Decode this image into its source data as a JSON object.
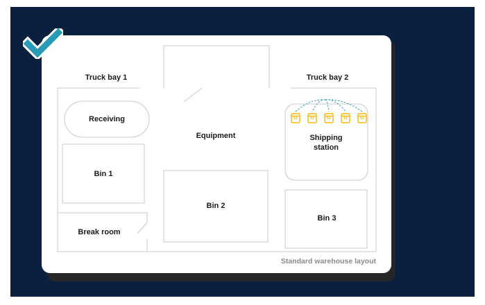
{
  "diagram": {
    "areas": {
      "truck_bay_1": "Truck bay 1",
      "truck_bay_2": "Truck bay 2",
      "receiving": "Receiving",
      "equipment": "Equipment",
      "shipping_station": "Shipping station",
      "bin_1": "Bin 1",
      "bin_2": "Bin 2",
      "bin_3": "Bin 3",
      "break_room": "Break room"
    },
    "caption": "Standard warehouse layout",
    "package_count": 5,
    "colors": {
      "background": "#0b1f3f",
      "card": "#ffffff",
      "card_shadow": "#262626",
      "outline": "#c8c8c8",
      "checkmark": "#2a9bb7",
      "package": "#f2b705",
      "route": "#2a9bb7",
      "caption": "#8a8a8a"
    },
    "icons": [
      "checkmark-icon",
      "package-icon"
    ]
  }
}
